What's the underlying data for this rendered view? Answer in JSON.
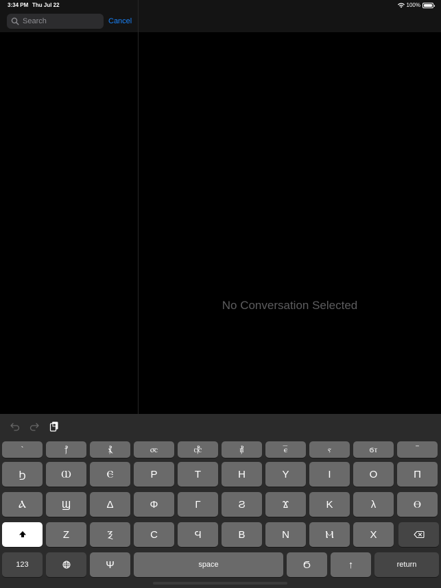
{
  "status_bar": {
    "time": "3:34 PM",
    "date": "Thu Jul 22",
    "battery": "100%"
  },
  "search": {
    "placeholder": "Search",
    "value": "",
    "cancel_label": "Cancel"
  },
  "detail": {
    "empty_message": "No Conversation Selected"
  },
  "keyboard": {
    "toolbar": {
      "icons": [
        "undo-icon",
        "redo-icon",
        "paste-icon"
      ]
    },
    "row0": [
      "`",
      "ⲯ",
      "ⲱ",
      "ⲱⲣ",
      "ⲣ",
      "ⲭⲣ",
      "ⲉ̄",
      "ⲋ",
      "ⲥⲧ",
      "¯"
    ],
    "row0_display": [
      "`",
      "⳨",
      "⳩",
      "⳪",
      "⳧",
      "⳦",
      "ⲉ̅",
      "ⲋ",
      "ϭⲧ",
      "‾"
    ],
    "row1": [
      "ϧ",
      "ⲱ",
      "ⲉ",
      "ⲣ",
      "ⲧ",
      "ⲏ",
      "ⲩ",
      "ⲓ",
      "ⲟ",
      "ⲡ"
    ],
    "row2": [
      "ⲁ",
      "ϣ",
      "ⲇ",
      "ⲫ",
      "ⲅ",
      "ϩ",
      "ϫ",
      "ⲕ",
      "ⲗ",
      "ⲑ"
    ],
    "row3": [
      "ⲍ",
      "ⲝ",
      "ⲥ",
      "ϥ",
      "ⲃ",
      "ⲛ",
      "ⲙ",
      "ⲭ"
    ],
    "row3_display": [
      "Ζ",
      "Ⲝ",
      "C",
      "Ϥ",
      "B",
      "N",
      "Ⲙ",
      "X"
    ],
    "row1_display": [
      "Ϧ",
      "Ⲱ",
      "Ⲉ",
      "P",
      "T",
      "H",
      "Y",
      "I",
      "O",
      "Π"
    ],
    "row2_display": [
      "Ⲁ",
      "Ϣ",
      "Δ",
      "Φ",
      "Γ",
      "Ϩ",
      "Ϫ",
      "K",
      "λ",
      "Ⲑ"
    ],
    "bottom": {
      "numbers_label": "123",
      "psi_label": "Ψ",
      "space_label": "space",
      "janja_label": "Ϭ",
      "up_label": "↑",
      "return_label": "return"
    }
  }
}
